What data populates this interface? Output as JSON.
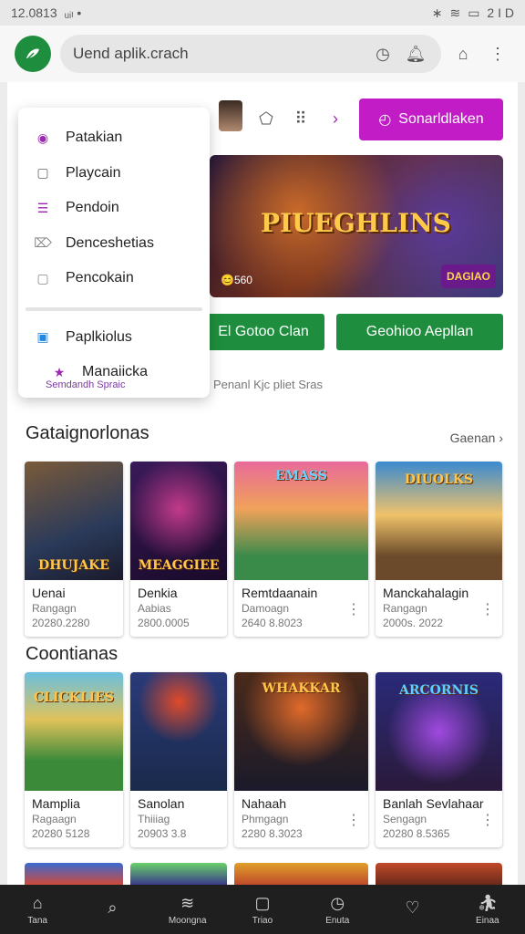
{
  "status_bar": {
    "time": "12.0813",
    "left_icons": "ᵤᵢₗ •",
    "right_text": "2 I D"
  },
  "top_bar": {
    "search_text": "Uend aplik.crach"
  },
  "hero": {
    "primary_button_label": "Sonarldlaken"
  },
  "banner": {
    "title": "PIUEGHLINS",
    "subtitle": "😊560",
    "logo_text": "DAGIAO"
  },
  "actions": {
    "left_button": "El Gotoo Clan",
    "right_button": "Geohioo Aepllan"
  },
  "meta_line": "Penanl Kjc pliet Sras",
  "dropdown": {
    "items": [
      {
        "label": "Patakian",
        "icon": "target-icon",
        "color": "#9c27b0"
      },
      {
        "label": "Playcain",
        "icon": "square-outline-icon",
        "color": "#666666"
      },
      {
        "label": "Pendoin",
        "icon": "list-icon",
        "color": "#9c27b0"
      },
      {
        "label": "Denceshetias",
        "icon": "tag-icon",
        "color": "#888888"
      },
      {
        "label": "Pencokain",
        "icon": "square-outline-icon",
        "color": "#888888"
      }
    ],
    "extra_items": [
      {
        "label": "Paplkiolus",
        "icon": "app-icon",
        "color": "#1e88e5"
      },
      {
        "label": "Manaiicka",
        "icon": "star-icon",
        "color": "#9c27b0"
      }
    ],
    "footnote": "Semdandh Spraic"
  },
  "sections": [
    {
      "title": "Gataignorlonas",
      "see_all": "Gaenan",
      "cards": [
        {
          "art_title": "DHUJAKE",
          "name": "Uenai",
          "sub": "Rangagn",
          "date": "20280.2280"
        },
        {
          "art_title": "MEAGGIEE",
          "name": "Denkia",
          "sub": "Aabias",
          "date": "2800.0005"
        },
        {
          "art_title": "EMASS",
          "name": "Remtdaanain",
          "sub": "Damoagn",
          "date": "2640 8.8023"
        },
        {
          "art_title": "DIUOLKS",
          "name": "Manckahalagin",
          "sub": "Rangagn",
          "date": "2000s. 2022"
        }
      ]
    },
    {
      "title": "Coontianas",
      "see_all": "",
      "cards": [
        {
          "art_title": "CLICKLIES",
          "name": "Mamplia",
          "sub": "Ragaagn",
          "date": "20280 5128"
        },
        {
          "art_title": "",
          "name": "Sanolan",
          "sub": "Thiiiag",
          "date": "20903 3.8"
        },
        {
          "art_title": "WHAKKAR",
          "name": "Nahaah",
          "sub": "Phmgagn",
          "date": "2280 8.3023"
        },
        {
          "art_title": "ARCORNIS",
          "name": "Banlah Sevlahaar",
          "sub": "Sengagn",
          "date": "20280 8.5365"
        }
      ]
    }
  ],
  "bottom_nav": [
    {
      "label": "Tana",
      "icon": "home-icon"
    },
    {
      "label": "",
      "icon": "search-icon"
    },
    {
      "label": "Moongna",
      "icon": "games-icon"
    },
    {
      "label": "Triao",
      "icon": "apps-icon"
    },
    {
      "label": "Enuta",
      "icon": "clock-icon"
    },
    {
      "label": "",
      "icon": "heart-icon"
    },
    {
      "label": "Einaa",
      "icon": "profile-icon"
    }
  ]
}
